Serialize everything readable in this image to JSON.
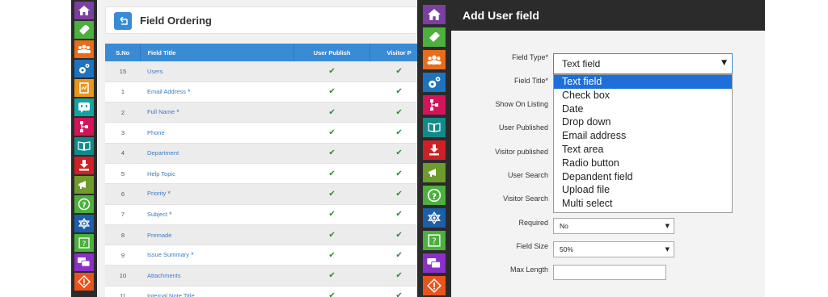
{
  "left_panel": {
    "title": "Field Ordering",
    "back_icon": "arrow-back-icon",
    "sidebar_icons": [
      "home-icon",
      "ticket-icon",
      "users-icon",
      "gears-icon",
      "report-icon",
      "chat-icon",
      "workflow-icon",
      "book-icon",
      "download-icon",
      "megaphone-icon",
      "help-icon",
      "network-icon",
      "question-card-icon",
      "messages-icon",
      "warning-icon"
    ],
    "table": {
      "headers": [
        "S.No",
        "Field Title",
        "User Publish",
        "Visitor P"
      ],
      "rows": [
        {
          "sno": "15",
          "title": "Users",
          "required": false
        },
        {
          "sno": "1",
          "title": "Email Address",
          "required": true
        },
        {
          "sno": "2",
          "title": "Full Name",
          "required": true
        },
        {
          "sno": "3",
          "title": "Phone",
          "required": false
        },
        {
          "sno": "4",
          "title": "Department",
          "required": false
        },
        {
          "sno": "5",
          "title": "Help Topic",
          "required": false
        },
        {
          "sno": "6",
          "title": "Priority",
          "required": true
        },
        {
          "sno": "7",
          "title": "Subject",
          "required": true
        },
        {
          "sno": "8",
          "title": "Premade",
          "required": false
        },
        {
          "sno": "9",
          "title": "Issue Summary",
          "required": true
        },
        {
          "sno": "10",
          "title": "Attachments",
          "required": false
        },
        {
          "sno": "11",
          "title": "Internal Note Title",
          "required": false
        }
      ],
      "check_mark": "✔",
      "required_mark": "*"
    }
  },
  "right_panel": {
    "title": "Add User field",
    "labels": {
      "field_type": "Field Type*",
      "field_title": "Field Title*",
      "show_on_listing": "Show On Listing",
      "user_published": "User Published",
      "visitor_published": "Visitor published",
      "user_search": "User Search",
      "visitor_search": "Visitor Search",
      "required": "Required",
      "field_size": "Field Size",
      "max_length": "Max Length"
    },
    "field_type_value": "Text field",
    "field_type_options": [
      "Text field",
      "Check box",
      "Date",
      "Drop down",
      "Email address",
      "Text area",
      "Radio button",
      "Depandent field",
      "Upload file",
      "Multi select"
    ],
    "required_value": "No",
    "field_size_value": "50%",
    "max_length_value": ""
  },
  "colors": {
    "accent": "#3a8bd6",
    "dark": "#2b2b2b",
    "check": "#2e8b2e",
    "selected_option": "#1e6fd9"
  }
}
